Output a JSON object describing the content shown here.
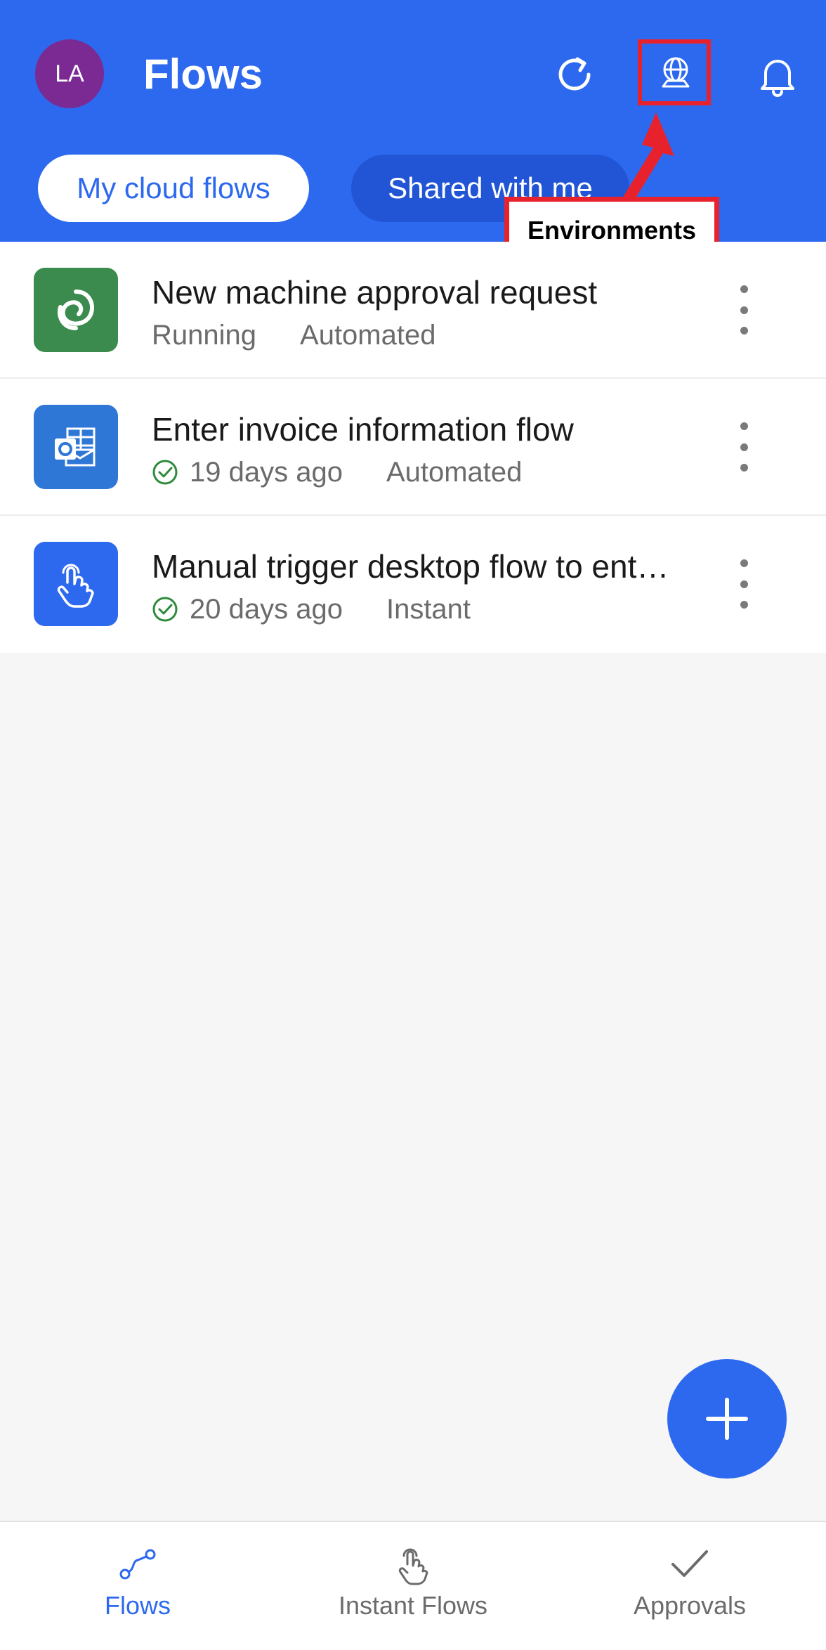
{
  "header": {
    "avatar_initials": "LA",
    "title": "Flows",
    "tabs": [
      {
        "label": "My cloud flows",
        "active": true
      },
      {
        "label": "Shared with me",
        "active": false
      }
    ],
    "icons": [
      "refresh-icon",
      "globe-icon",
      "bell-icon"
    ]
  },
  "callout": {
    "label": "Environments",
    "color": "#e8222c"
  },
  "flows": [
    {
      "title": "New machine approval request",
      "status": "Running",
      "status_icon": null,
      "type": "Automated",
      "icon": "dataverse-icon",
      "icon_color": "#3a8b4d"
    },
    {
      "title": "Enter invoice information flow",
      "status": "19 days ago",
      "status_icon": "check-circle-icon",
      "type": "Automated",
      "icon": "outlook-icon",
      "icon_color": "#2f77d6"
    },
    {
      "title": "Manual trigger desktop flow to ent…",
      "status": "20 days ago",
      "status_icon": "check-circle-icon",
      "type": "Instant",
      "icon": "touch-icon",
      "icon_color": "#2d69ee"
    }
  ],
  "fab": {
    "icon": "plus-icon"
  },
  "bottom_nav": [
    {
      "label": "Flows",
      "icon": "flows-icon",
      "active": true
    },
    {
      "label": "Instant Flows",
      "icon": "touch-icon",
      "active": false
    },
    {
      "label": "Approvals",
      "icon": "checkmark-icon",
      "active": false
    }
  ],
  "colors": {
    "brand": "#2d69ee",
    "avatar": "#7a2a92",
    "success": "#2f8a3a",
    "background": "#f6f6f6"
  }
}
